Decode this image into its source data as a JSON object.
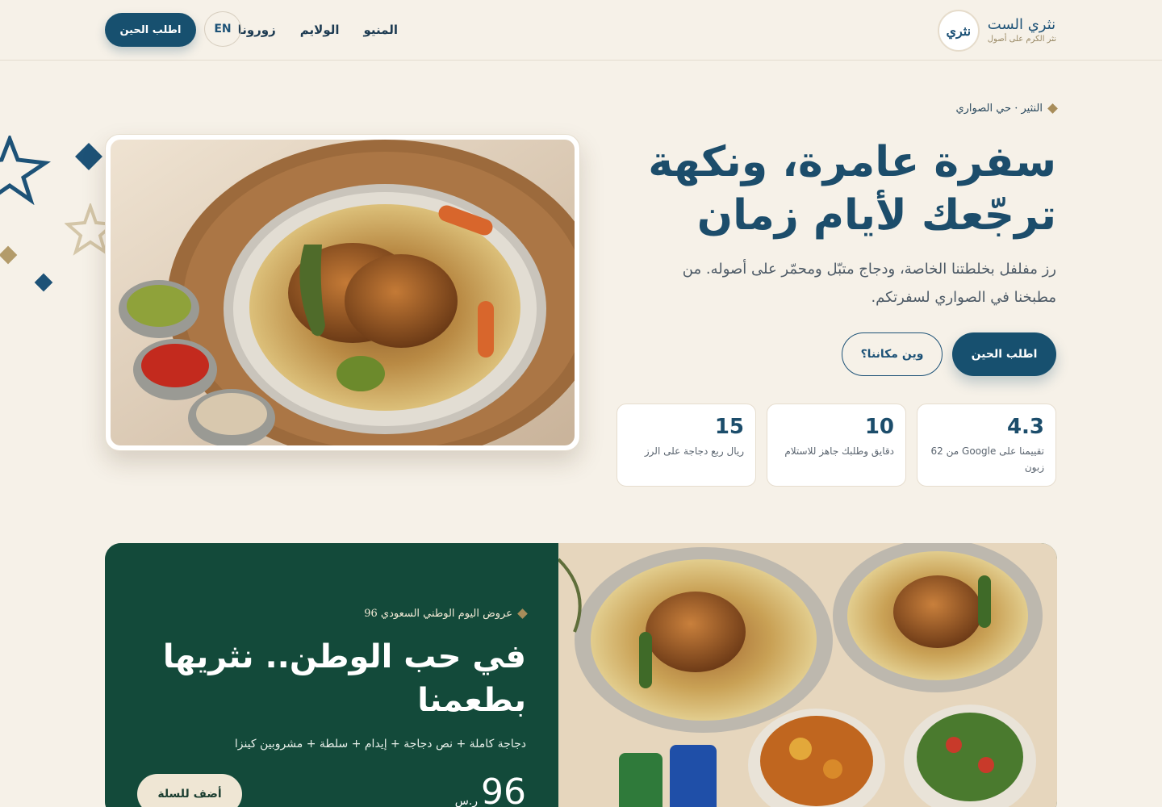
{
  "brand": {
    "logo_text": "نثري",
    "name": "نثري الست",
    "tagline": "نثر الكرم على أصول"
  },
  "nav": {
    "items": [
      "المنيو",
      "الولايم",
      "زورونا"
    ],
    "lang": "EN",
    "order_label": "اطلب الحين"
  },
  "hero": {
    "eyebrow": "النثير · حي الصواري",
    "title": "سفرة عامرة، ونكهة ترجّعك لأيام زمان",
    "description": "رز مفلفل بخلطتنا الخاصة، ودجاج متبّل ومحمّر على أصوله. من مطبخنا في الصواري لسفرتكم.",
    "primary_button": "اطلب الحين",
    "secondary_button": "وين مكاننا؟",
    "stats": [
      {
        "value": "4.3",
        "label": "تقييمنا على Google من 62 زبون"
      },
      {
        "value": "10",
        "label": "دقايق وطلبك جاهز للاستلام"
      },
      {
        "value": "15",
        "label": "ريال ربع دجاجة على الرز"
      }
    ]
  },
  "offer": {
    "eyebrow": "عروض اليوم الوطني السعودي 96",
    "title": "في حب الوطن.. نثريها بطعمنا",
    "description": "دجاجة كاملة + نص دجاجة + إيدام + سلطة + مشروبين كينزا",
    "price": "96",
    "currency": "ر.س",
    "cart_button": "أضف للسلة"
  },
  "colors": {
    "background": "#f6f1e8",
    "primary": "#17506f",
    "offer_green": "#134a3a",
    "accent_gold": "#a88d5a"
  },
  "icons": [
    "star-outline-icon",
    "diamond-icon",
    "brand-logo-icon"
  ]
}
